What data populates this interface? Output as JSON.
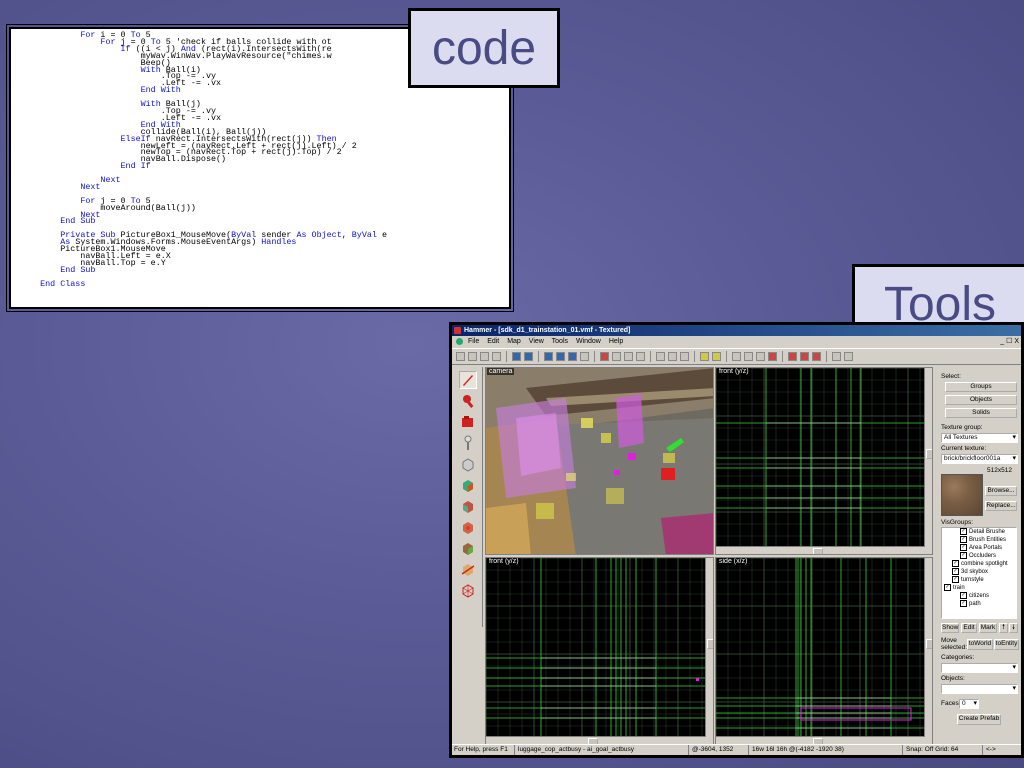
{
  "labels": {
    "code": "code",
    "tools": "Tools"
  },
  "code_lines": [
    [
      [
        "            "
      ],
      [
        "For",
        "kw"
      ],
      [
        " i = 0 "
      ],
      [
        "To",
        "kw"
      ],
      [
        " 5"
      ]
    ],
    [
      [
        "                "
      ],
      [
        "For",
        "kw"
      ],
      [
        " j = 0 "
      ],
      [
        "To",
        "kw"
      ],
      [
        " 5 'check if balls collide with ot"
      ]
    ],
    [
      [
        "                    "
      ],
      [
        "If",
        "kw"
      ],
      [
        " ((i < j) "
      ],
      [
        "And",
        "kw"
      ],
      [
        " (rect(i).IntersectsWith(re"
      ]
    ],
    [
      [
        "                        myWav.WinWav.PlayWavResource(\"chimes.w"
      ]
    ],
    [
      [
        "                        Beep()"
      ]
    ],
    [
      [
        "                        "
      ],
      [
        "With",
        "kw"
      ],
      [
        " Ball(i)"
      ]
    ],
    [
      [
        "                            .Top -= .vy"
      ]
    ],
    [
      [
        "                            .Left -= .vx"
      ]
    ],
    [
      [
        "                        "
      ],
      [
        "End With",
        "kw"
      ]
    ],
    [
      [
        ""
      ]
    ],
    [
      [
        "                        "
      ],
      [
        "With",
        "kw"
      ],
      [
        " Ball(j)"
      ]
    ],
    [
      [
        "                            .Top -= .vy"
      ]
    ],
    [
      [
        "                            .Left -= .vx"
      ]
    ],
    [
      [
        "                        "
      ],
      [
        "End With",
        "kw"
      ]
    ],
    [
      [
        "                        collide(Ball(i), Ball(j))"
      ]
    ],
    [
      [
        "                    "
      ],
      [
        "ElseIf",
        "kw"
      ],
      [
        " navRect.IntersectsWith(rect(j)) "
      ],
      [
        "Then",
        "kw"
      ]
    ],
    [
      [
        "                        newLeft = (navRect.Left + rect(j).Left) / 2"
      ]
    ],
    [
      [
        "                        newTop = (navRect.Top + rect(j).Top) / 2"
      ]
    ],
    [
      [
        "                        navBall.Dispose()"
      ]
    ],
    [
      [
        "                    "
      ],
      [
        "End If",
        "kw"
      ]
    ],
    [
      [
        ""
      ]
    ],
    [
      [
        "                "
      ],
      [
        "Next",
        "kw"
      ]
    ],
    [
      [
        "            "
      ],
      [
        "Next",
        "kw"
      ]
    ],
    [
      [
        ""
      ]
    ],
    [
      [
        "            "
      ],
      [
        "For",
        "kw"
      ],
      [
        " j = 0 "
      ],
      [
        "To",
        "kw"
      ],
      [
        " 5"
      ]
    ],
    [
      [
        "                moveAround(Ball(j))"
      ]
    ],
    [
      [
        "            "
      ],
      [
        "Next",
        "kw"
      ]
    ],
    [
      [
        "        "
      ],
      [
        "End Sub",
        "kw"
      ]
    ],
    [
      [
        ""
      ]
    ],
    [
      [
        "        "
      ],
      [
        "Private Sub",
        "kw"
      ],
      [
        " PictureBox1_MouseMove("
      ],
      [
        "ByVal",
        "kw"
      ],
      [
        " sender "
      ],
      [
        "As Object",
        "kw"
      ],
      [
        ", "
      ],
      [
        "ByVal",
        "kw"
      ],
      [
        " e"
      ]
    ],
    [
      [
        "        "
      ],
      [
        "As",
        "kw"
      ],
      [
        " System.Windows.Forms.MouseEventArgs) "
      ],
      [
        "Handles",
        "kw"
      ]
    ],
    [
      [
        "        PictureBox1.MouseMove"
      ]
    ],
    [
      [
        "            navBall.Left = e.X"
      ]
    ],
    [
      [
        "            navBall.Top = e.Y"
      ]
    ],
    [
      [
        "        "
      ],
      [
        "End Sub",
        "kw"
      ]
    ],
    [
      [
        ""
      ]
    ],
    [
      [
        "    "
      ],
      [
        "End Class",
        "kw"
      ]
    ]
  ],
  "hammer": {
    "title": "Hammer - [sdk_d1_trainstation_01.vmf - Textured]",
    "menu": [
      "File",
      "Edit",
      "Map",
      "View",
      "Tools",
      "Window",
      "Help"
    ],
    "window_buttons": "_ ☐ X",
    "viewports": {
      "camera": "camera",
      "top_right": "front (y/z)",
      "bottom_left": "front (y/z)",
      "bottom_right": "side (x/z)"
    },
    "panel": {
      "select_label": "Select:",
      "groups": "Groups",
      "objects": "Objects",
      "solids": "Solids",
      "texture_group_label": "Texture group:",
      "texture_group_value": "All Textures",
      "current_texture_label": "Current texture:",
      "current_texture_value": "brick/brickfloor001a",
      "texture_size": "512x512",
      "browse": "Browse...",
      "replace": "Replace...",
      "visgroups_label": "VisGroups:",
      "visgroups": [
        {
          "label": "Detail Brushe",
          "indent": 2,
          "checked": true
        },
        {
          "label": "Brush Entities",
          "indent": 2,
          "checked": true
        },
        {
          "label": "Area Portals",
          "indent": 2,
          "checked": true
        },
        {
          "label": "Occluders",
          "indent": 2,
          "checked": true
        },
        {
          "label": "combine spotlight",
          "indent": 1,
          "checked": true
        },
        {
          "label": "3d skybox",
          "indent": 1,
          "checked": true
        },
        {
          "label": "turnstyle",
          "indent": 1,
          "checked": true
        },
        {
          "label": "train",
          "indent": 0,
          "checked": true
        },
        {
          "label": "citizens",
          "indent": 2,
          "checked": true
        },
        {
          "label": "path",
          "indent": 2,
          "checked": true
        }
      ],
      "show": "Show",
      "edit": "Edit",
      "mark": "Mark",
      "up": "🠕",
      "down": "🠗",
      "move_selected": "Move selected:",
      "to_world": "toWorld",
      "to_entity": "toEntity",
      "categories_label": "Categories:",
      "objects_label": "Objects:",
      "faces_label": "Faces:",
      "faces_value": "0",
      "create_prefab": "Create Prefab"
    },
    "status": {
      "help": "For Help, press F1",
      "object": "luggage_cop_actbusy - ai_goal_actbusy",
      "coords": "@-3604, 1352",
      "size": "16w 16l 16h @(-4182 -1920 38)",
      "snap": "Snap: Off Grid: 64",
      "arrow": "<->"
    }
  }
}
